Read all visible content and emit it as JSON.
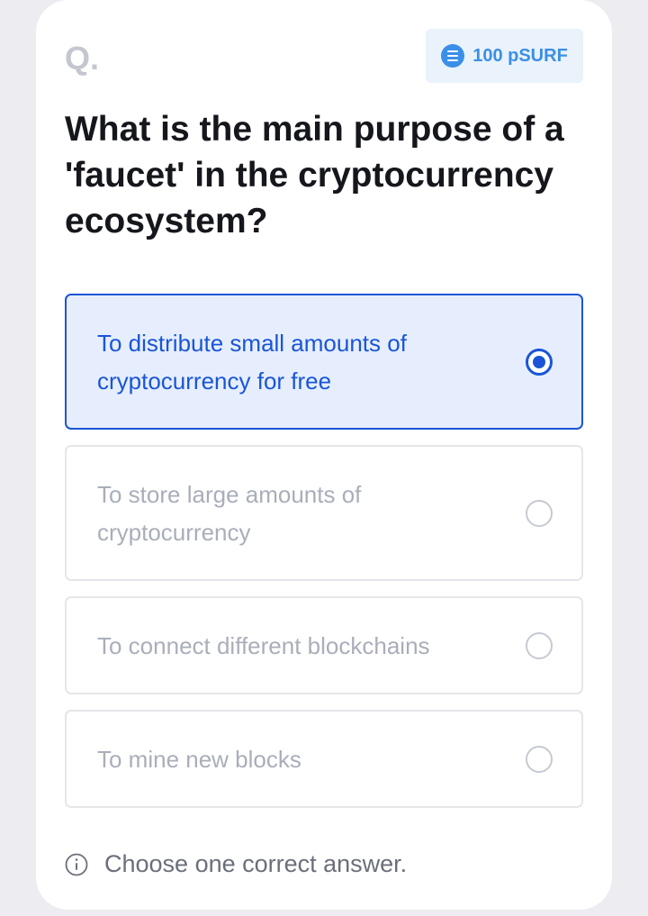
{
  "question": {
    "marker": "Q.",
    "text": "What is the main purpose of a 'faucet' in the cryptocurrency ecosystem?"
  },
  "reward": {
    "icon": "coin-icon",
    "label": "100 pSURF",
    "color": "#3a8fe6"
  },
  "options": [
    {
      "label": "To distribute small amounts of cryptocurrency for free",
      "selected": true
    },
    {
      "label": "To store large amounts of cryptocurrency",
      "selected": false
    },
    {
      "label": "To connect different blockchains",
      "selected": false
    },
    {
      "label": "To mine new blocks",
      "selected": false
    }
  ],
  "hint": {
    "icon": "info-icon",
    "text": "Choose one correct answer."
  },
  "colors": {
    "accent": "#1a55d6",
    "selected_background": "#e6eefd",
    "unselected_text": "#a9aeb9"
  }
}
